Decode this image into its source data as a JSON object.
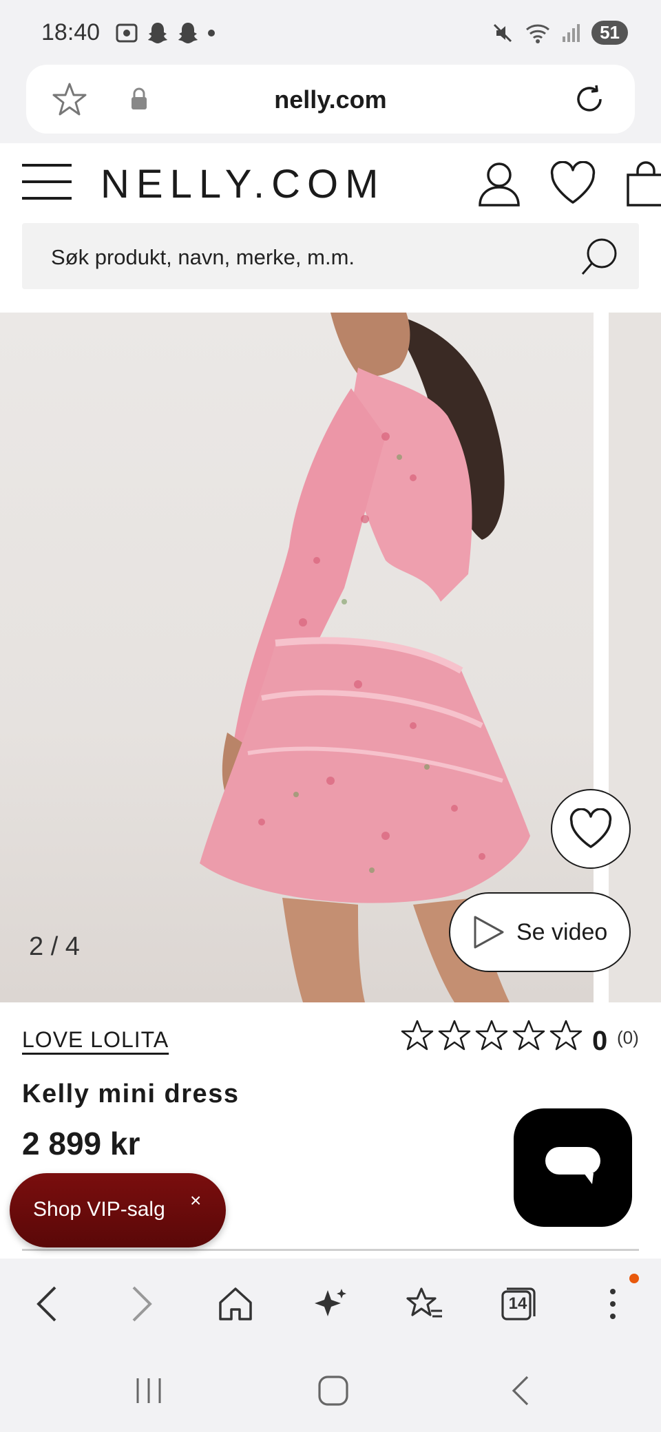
{
  "status_bar": {
    "time": "18:40",
    "battery": "51"
  },
  "browser": {
    "url": "nelly.com"
  },
  "site": {
    "logo": "NELLY.COM",
    "search_placeholder": "Søk produkt, navn, merke, m.m."
  },
  "gallery": {
    "counter": "2 / 4",
    "video_label": "Se video"
  },
  "product": {
    "brand": "LOVE LOLITA",
    "name": "Kelly mini dress",
    "price": "2 899 kr",
    "rating": {
      "value": "0",
      "count": "(0)",
      "stars_filled": 0,
      "stars_total": 5
    }
  },
  "promo": {
    "label": "Shop VIP-salg",
    "close": "×"
  },
  "toolbar": {
    "tab_count": "14"
  },
  "colors": {
    "vip_bg": "#6a0b0b",
    "notification_dot": "#e8590c",
    "dress_pink": "#ec9cab"
  }
}
